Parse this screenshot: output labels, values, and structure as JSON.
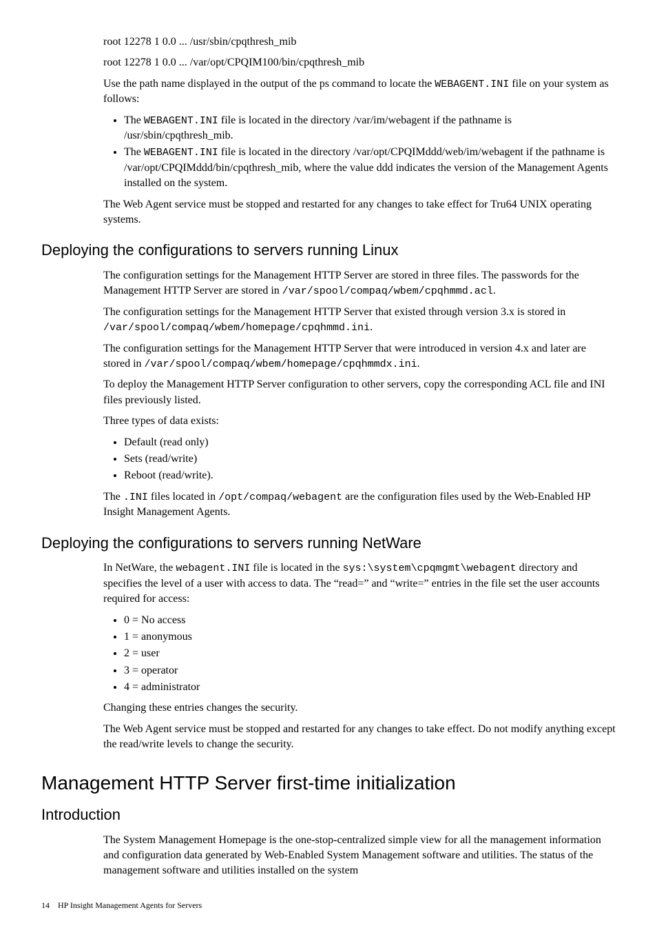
{
  "top": {
    "line1": "root 12278 1 0.0 ... /usr/sbin/cpqthresh_mib",
    "line2": "root 12278 1 0.0 ... /var/opt/CPQIM100/bin/cpqthresh_mib",
    "p1a": "Use the path name displayed in the output of the ps command to locate the ",
    "p1code": "WEBAGENT.INI",
    "p1b": " file on your system as follows:",
    "b1a": "The ",
    "b1code": "WEBAGENT.INI",
    "b1b": " file is located in the directory /var/im/webagent if the pathname is /usr/sbin/cpqthresh_mib.",
    "b2a": "The ",
    "b2code": "WEBAGENT.INI",
    "b2b": " file is located in the directory /var/opt/CPQIMddd/web/im/webagent if the pathname is /var/opt/CPQIMddd/bin/cpqthresh_mib, where the value ddd indicates the version of the Management Agents installed on the system.",
    "p2": "The Web Agent service must be stopped and restarted for any changes to take effect for Tru64 UNIX operating systems."
  },
  "linux": {
    "heading": "Deploying the configurations to servers running Linux",
    "p1a": "The configuration settings for the Management HTTP Server  are stored in three files. The passwords for the Management HTTP Server are stored in ",
    "p1code": "/var/spool/compaq/wbem/cpqhmmd.acl",
    "p1b": ".",
    "p2a": "The configuration settings for the Management HTTP Server that existed through version 3.x is stored in ",
    "p2code": "/var/spool/compaq/wbem/homepage/cpqhmmd.ini",
    "p2b": ".",
    "p3a": "The configuration settings for the Management HTTP Server that were introduced in version 4.x and later are stored in ",
    "p3code": "/var/spool/compaq/wbem/homepage/cpqhmmdx.ini",
    "p3b": ".",
    "p4": "To deploy the Management HTTP Server configuration to other servers, copy the corresponding ACL file and INI files previously listed.",
    "p5": "Three types of data exists:",
    "b1": "Default (read only)",
    "b2": "Sets (read/write)",
    "b3": "Reboot (read/write).",
    "p6a": "The ",
    "p6code1": ".INI",
    "p6b": " files located in ",
    "p6code2": "/opt/compaq/webagent",
    "p6c": " are the configuration files used by the Web-Enabled HP Insight Management Agents."
  },
  "netware": {
    "heading": "Deploying the configurations to servers running NetWare",
    "p1a": "In NetWare, the ",
    "p1code1": "webagent.INI",
    "p1b": " file is located in the ",
    "p1code2": "sys:\\system\\cpqmgmt\\webagent",
    "p1c": " directory and specifies the level of a user with access to data. The “read=” and “write=” entries in the file set the user accounts required for access:",
    "b1": "0 = No access",
    "b2": "1 = anonymous",
    "b3": "2 = user",
    "b4": "3 = operator",
    "b5": "4 = administrator",
    "p2": "Changing these entries changes the security.",
    "p3": "The Web Agent service must be stopped and restarted for any changes to take effect. Do not modify anything except the read/write levels to change the security."
  },
  "mgmt": {
    "heading": "Management HTTP Server first-time initialization",
    "sub": "Introduction",
    "p1": "The System Management Homepage is the one-stop-centralized simple view for all the management information and configuration data generated by Web-Enabled System Management software and utilities. The status of the management software and utilities installed on the system"
  },
  "footer": {
    "page": "14",
    "title": "HP Insight Management Agents for Servers"
  }
}
